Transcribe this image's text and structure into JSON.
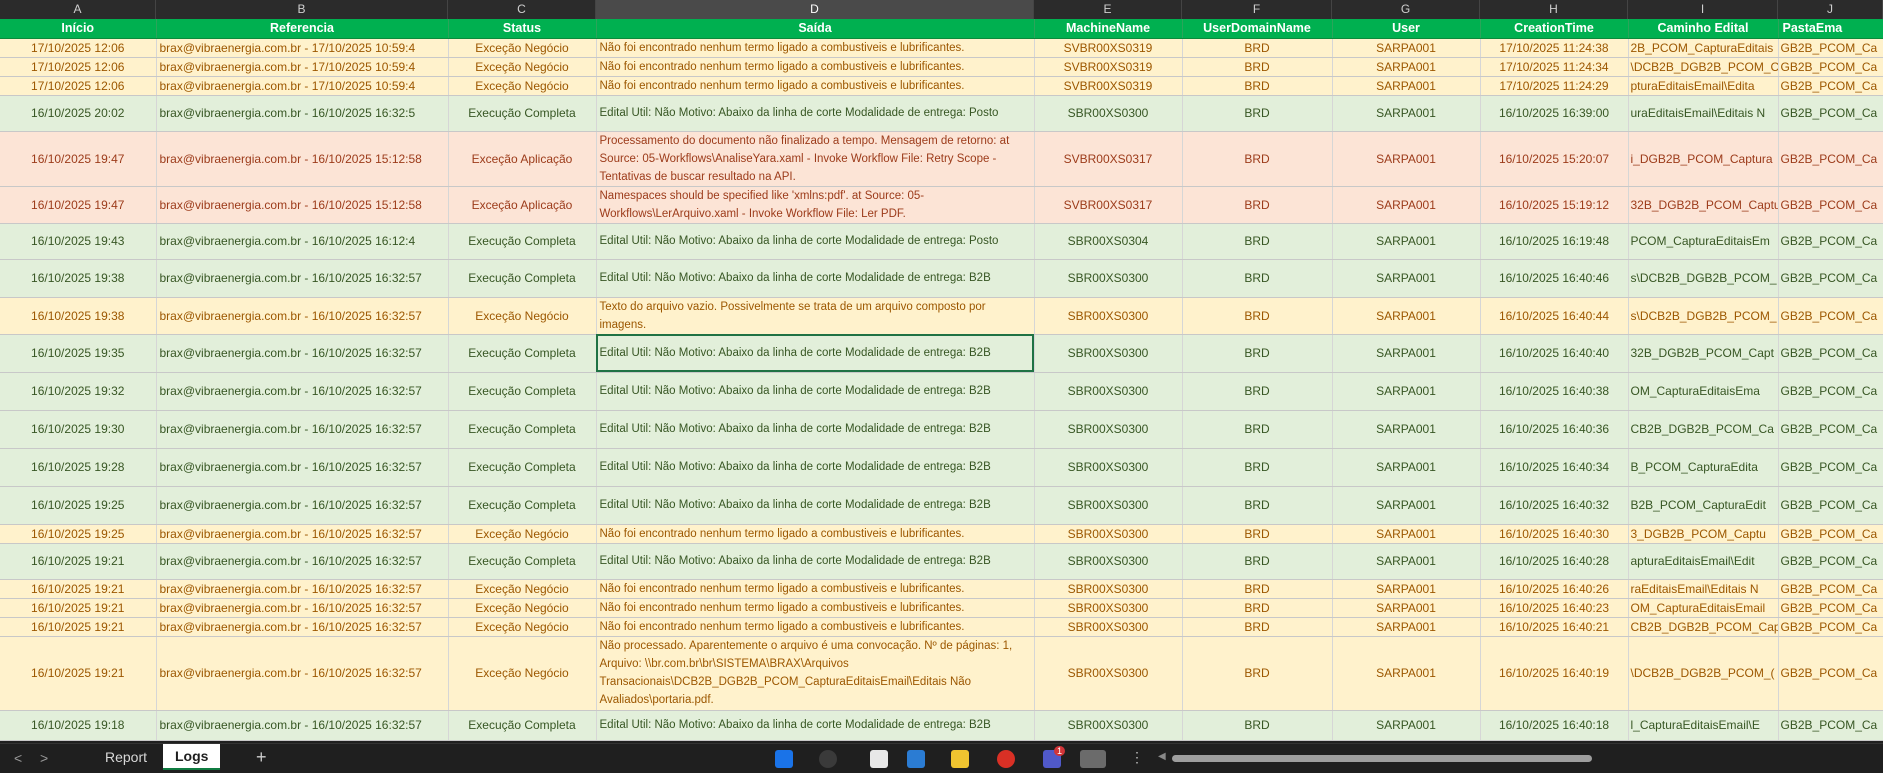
{
  "columns": [
    "A",
    "B",
    "C",
    "D",
    "E",
    "F",
    "G",
    "H",
    "I",
    "J"
  ],
  "selected_column": "D",
  "headers": [
    "Início",
    "Referencia",
    "Status",
    "Saída",
    "MachineName",
    "UserDomainName",
    "User",
    "CreationTime",
    "Caminho Edital",
    "PastaEma"
  ],
  "rows": [
    {
      "inicio": "17/10/2025 12:06",
      "ref": "brax@vibraenergia.com.br - 17/10/2025 10:59:4",
      "status": "Exceção Negócio",
      "saida": "Não foi encontrado nenhum termo ligado a combustiveis e lubrificantes.",
      "machine": "SVBR00XS0319",
      "domain": "BRD",
      "user": "SARPA001",
      "created": "17/10/2025 11:24:38",
      "caminho": "2B_PCOM_CapturaEditais",
      "pasta": "GB2B_PCOM_Ca",
      "kind": "negocio"
    },
    {
      "inicio": "17/10/2025 12:06",
      "ref": "brax@vibraenergia.com.br - 17/10/2025 10:59:4",
      "status": "Exceção Negócio",
      "saida": "Não foi encontrado nenhum termo ligado a combustiveis e lubrificantes.",
      "machine": "SVBR00XS0319",
      "domain": "BRD",
      "user": "SARPA001",
      "created": "17/10/2025 11:24:34",
      "caminho": "\\DCB2B_DGB2B_PCOM_C",
      "pasta": "GB2B_PCOM_Ca",
      "kind": "negocio"
    },
    {
      "inicio": "17/10/2025 12:06",
      "ref": "brax@vibraenergia.com.br - 17/10/2025 10:59:4",
      "status": "Exceção Negócio",
      "saida": "Não foi encontrado nenhum termo ligado a combustiveis e lubrificantes.",
      "machine": "SVBR00XS0319",
      "domain": "BRD",
      "user": "SARPA001",
      "created": "17/10/2025 11:24:29",
      "caminho": "pturaEditaisEmail\\Edita",
      "pasta": "GB2B_PCOM_Ca",
      "kind": "negocio"
    },
    {
      "inicio": "16/10/2025 20:02",
      "ref": "brax@vibraenergia.com.br - 16/10/2025 16:32:5",
      "status": "Execução Completa",
      "saida": "Edital Util: Não Motivo: Abaixo da linha de corte Modalidade de entrega: Posto",
      "machine": "SBR00XS0300",
      "domain": "BRD",
      "user": "SARPA001",
      "created": "16/10/2025 16:39:00",
      "caminho": "uraEditaisEmail\\Editais N",
      "pasta": "GB2B_PCOM_Ca",
      "kind": "complete"
    },
    {
      "inicio": "16/10/2025 19:47",
      "ref": "brax@vibraenergia.com.br - 16/10/2025 15:12:58",
      "status": "Exceção Aplicação",
      "saida": "Processamento do documento não finalizado a tempo. Mensagem de retorno: at Source: 05-Workflows\\AnaliseYara.xaml - Invoke Workflow File: Retry Scope - Tentativas de buscar resultado na API.",
      "machine": "SVBR00XS0317",
      "domain": "BRD",
      "user": "SARPA001",
      "created": "16/10/2025 15:20:07",
      "caminho": "i_DGB2B_PCOM_Captura",
      "pasta": "GB2B_PCOM_Ca",
      "kind": "aplicacao"
    },
    {
      "inicio": "16/10/2025 19:47",
      "ref": "brax@vibraenergia.com.br - 16/10/2025 15:12:58",
      "status": "Exceção Aplicação",
      "saida": "Namespaces should be specified like 'xmlns:pdf'. at Source: 05-Workflows\\LerArquivo.xaml - Invoke Workflow File: Ler PDF.",
      "machine": "SVBR00XS0317",
      "domain": "BRD",
      "user": "SARPA001",
      "created": "16/10/2025 15:19:12",
      "caminho": "32B_DGB2B_PCOM_Captu",
      "pasta": "GB2B_PCOM_Ca",
      "kind": "aplicacao"
    },
    {
      "inicio": "16/10/2025 19:43",
      "ref": "brax@vibraenergia.com.br - 16/10/2025 16:12:4",
      "status": "Execução Completa",
      "saida": "Edital Util: Não Motivo: Abaixo da linha de corte Modalidade de entrega: Posto",
      "machine": "SBR00XS0304",
      "domain": "BRD",
      "user": "SARPA001",
      "created": "16/10/2025 16:19:48",
      "caminho": "PCOM_CapturaEditaisEm",
      "pasta": "GB2B_PCOM_Ca",
      "kind": "complete"
    },
    {
      "inicio": "16/10/2025 19:38",
      "ref": "brax@vibraenergia.com.br - 16/10/2025 16:32:57",
      "status": "Execução Completa",
      "saida": "Edital Util: Não Motivo: Abaixo da linha de corte Modalidade de entrega: B2B",
      "machine": "SBR00XS0300",
      "domain": "BRD",
      "user": "SARPA001",
      "created": "16/10/2025 16:40:46",
      "caminho": "s\\DCB2B_DGB2B_PCOM_",
      "pasta": "GB2B_PCOM_Ca",
      "kind": "complete"
    },
    {
      "inicio": "16/10/2025 19:38",
      "ref": "brax@vibraenergia.com.br - 16/10/2025 16:32:57",
      "status": "Exceção Negócio",
      "saida": "Texto do arquivo vazio. Possivelmente se trata de um arquivo composto por imagens.",
      "machine": "SBR00XS0300",
      "domain": "BRD",
      "user": "SARPA001",
      "created": "16/10/2025 16:40:44",
      "caminho": "s\\DCB2B_DGB2B_PCOM_",
      "pasta": "GB2B_PCOM_Ca",
      "kind": "negocio"
    },
    {
      "inicio": "16/10/2025 19:35",
      "ref": "brax@vibraenergia.com.br - 16/10/2025 16:32:57",
      "status": "Execução Completa",
      "saida": "Edital Util: Não Motivo: Abaixo da linha de corte Modalidade de entrega: B2B",
      "machine": "SBR00XS0300",
      "domain": "BRD",
      "user": "SARPA001",
      "created": "16/10/2025 16:40:40",
      "caminho": "32B_DGB2B_PCOM_Capt",
      "pasta": "GB2B_PCOM_Ca",
      "kind": "complete",
      "active": true
    },
    {
      "inicio": "16/10/2025 19:32",
      "ref": "brax@vibraenergia.com.br - 16/10/2025 16:32:57",
      "status": "Execução Completa",
      "saida": "Edital Util: Não Motivo: Abaixo da linha de corte Modalidade de entrega: B2B",
      "machine": "SBR00XS0300",
      "domain": "BRD",
      "user": "SARPA001",
      "created": "16/10/2025 16:40:38",
      "caminho": "OM_CapturaEditaisEma",
      "pasta": "GB2B_PCOM_Ca",
      "kind": "complete"
    },
    {
      "inicio": "16/10/2025 19:30",
      "ref": "brax@vibraenergia.com.br - 16/10/2025 16:32:57",
      "status": "Execução Completa",
      "saida": "Edital Util: Não Motivo: Abaixo da linha de corte Modalidade de entrega: B2B",
      "machine": "SBR00XS0300",
      "domain": "BRD",
      "user": "SARPA001",
      "created": "16/10/2025 16:40:36",
      "caminho": "CB2B_DGB2B_PCOM_Ca",
      "pasta": "GB2B_PCOM_Ca",
      "kind": "complete"
    },
    {
      "inicio": "16/10/2025 19:28",
      "ref": "brax@vibraenergia.com.br - 16/10/2025 16:32:57",
      "status": "Execução Completa",
      "saida": "Edital Util: Não Motivo: Abaixo da linha de corte Modalidade de entrega: B2B",
      "machine": "SBR00XS0300",
      "domain": "BRD",
      "user": "SARPA001",
      "created": "16/10/2025 16:40:34",
      "caminho": "B_PCOM_CapturaEdita",
      "pasta": "GB2B_PCOM_Ca",
      "kind": "complete"
    },
    {
      "inicio": "16/10/2025 19:25",
      "ref": "brax@vibraenergia.com.br - 16/10/2025 16:32:57",
      "status": "Execução Completa",
      "saida": "Edital Util: Não Motivo: Abaixo da linha de corte Modalidade de entrega: B2B",
      "machine": "SBR00XS0300",
      "domain": "BRD",
      "user": "SARPA001",
      "created": "16/10/2025 16:40:32",
      "caminho": "B2B_PCOM_CapturaEdit",
      "pasta": "GB2B_PCOM_Ca",
      "kind": "complete"
    },
    {
      "inicio": "16/10/2025 19:25",
      "ref": "brax@vibraenergia.com.br - 16/10/2025 16:32:57",
      "status": "Exceção Negócio",
      "saida": "Não foi encontrado nenhum termo ligado a combustiveis e lubrificantes.",
      "machine": "SBR00XS0300",
      "domain": "BRD",
      "user": "SARPA001",
      "created": "16/10/2025 16:40:30",
      "caminho": "3_DGB2B_PCOM_Captu",
      "pasta": "GB2B_PCOM_Ca",
      "kind": "negocio"
    },
    {
      "inicio": "16/10/2025 19:21",
      "ref": "brax@vibraenergia.com.br - 16/10/2025 16:32:57",
      "status": "Execução Completa",
      "saida": "Edital Util: Não Motivo: Abaixo da linha de corte Modalidade de entrega: B2B",
      "machine": "SBR00XS0300",
      "domain": "BRD",
      "user": "SARPA001",
      "created": "16/10/2025 16:40:28",
      "caminho": "apturaEditaisEmail\\Edit",
      "pasta": "GB2B_PCOM_Ca",
      "kind": "complete"
    },
    {
      "inicio": "16/10/2025 19:21",
      "ref": "brax@vibraenergia.com.br - 16/10/2025 16:32:57",
      "status": "Exceção Negócio",
      "saida": "Não foi encontrado nenhum termo ligado a combustiveis e lubrificantes.",
      "machine": "SBR00XS0300",
      "domain": "BRD",
      "user": "SARPA001",
      "created": "16/10/2025 16:40:26",
      "caminho": "raEditaisEmail\\Editais N",
      "pasta": "GB2B_PCOM_Ca",
      "kind": "negocio"
    },
    {
      "inicio": "16/10/2025 19:21",
      "ref": "brax@vibraenergia.com.br - 16/10/2025 16:32:57",
      "status": "Exceção Negócio",
      "saida": "Não foi encontrado nenhum termo ligado a combustiveis e lubrificantes.",
      "machine": "SBR00XS0300",
      "domain": "BRD",
      "user": "SARPA001",
      "created": "16/10/2025 16:40:23",
      "caminho": "OM_CapturaEditaisEmail",
      "pasta": "GB2B_PCOM_Ca",
      "kind": "negocio"
    },
    {
      "inicio": "16/10/2025 19:21",
      "ref": "brax@vibraenergia.com.br - 16/10/2025 16:32:57",
      "status": "Exceção Negócio",
      "saida": "Não foi encontrado nenhum termo ligado a combustiveis e lubrificantes.",
      "machine": "SBR00XS0300",
      "domain": "BRD",
      "user": "SARPA001",
      "created": "16/10/2025 16:40:21",
      "caminho": "CB2B_DGB2B_PCOM_Cap",
      "pasta": "GB2B_PCOM_Ca",
      "kind": "negocio"
    },
    {
      "inicio": "16/10/2025 19:21",
      "ref": "brax@vibraenergia.com.br - 16/10/2025 16:32:57",
      "status": "Exceção Negócio",
      "saida": "Não processado. Aparentemente o arquivo é uma convocação. Nº de páginas: 1, Arquivo: \\\\br.com.br\\br\\SISTEMA\\BRAX\\Arquivos Transacionais\\DCB2B_DGB2B_PCOM_CapturaEditaisEmail\\Editais Não Avaliados\\portaria.pdf.",
      "machine": "SBR00XS0300",
      "domain": "BRD",
      "user": "SARPA001",
      "created": "16/10/2025 16:40:19",
      "caminho": "\\DCB2B_DGB2B_PCOM_(",
      "pasta": "GB2B_PCOM_Ca",
      "kind": "negocio"
    },
    {
      "inicio": "16/10/2025 19:18",
      "ref": "brax@vibraenergia.com.br - 16/10/2025 16:32:57",
      "status": "Execução Completa",
      "saida": "Edital Util: Não Motivo: Abaixo da linha de corte Modalidade de entrega: B2B",
      "machine": "SBR00XS0300",
      "domain": "BRD",
      "user": "SARPA001",
      "created": "16/10/2025 16:40:18",
      "caminho": "l_CapturaEditaisEmail\\E",
      "pasta": "GB2B_PCOM_Ca",
      "kind": "complete"
    }
  ],
  "sheets": [
    "Report",
    "Logs"
  ],
  "active_sheet": "Logs",
  "add_sheet_label": "+",
  "nav_prev": "<",
  "nav_next": ">",
  "more_label": "⋮",
  "notification_count": "1",
  "colors": {
    "header_green": "#00b050",
    "complete_fill": "#e2efda",
    "negocio_fill": "#fff2cc",
    "aplicacao_fill": "#fce4d6"
  }
}
